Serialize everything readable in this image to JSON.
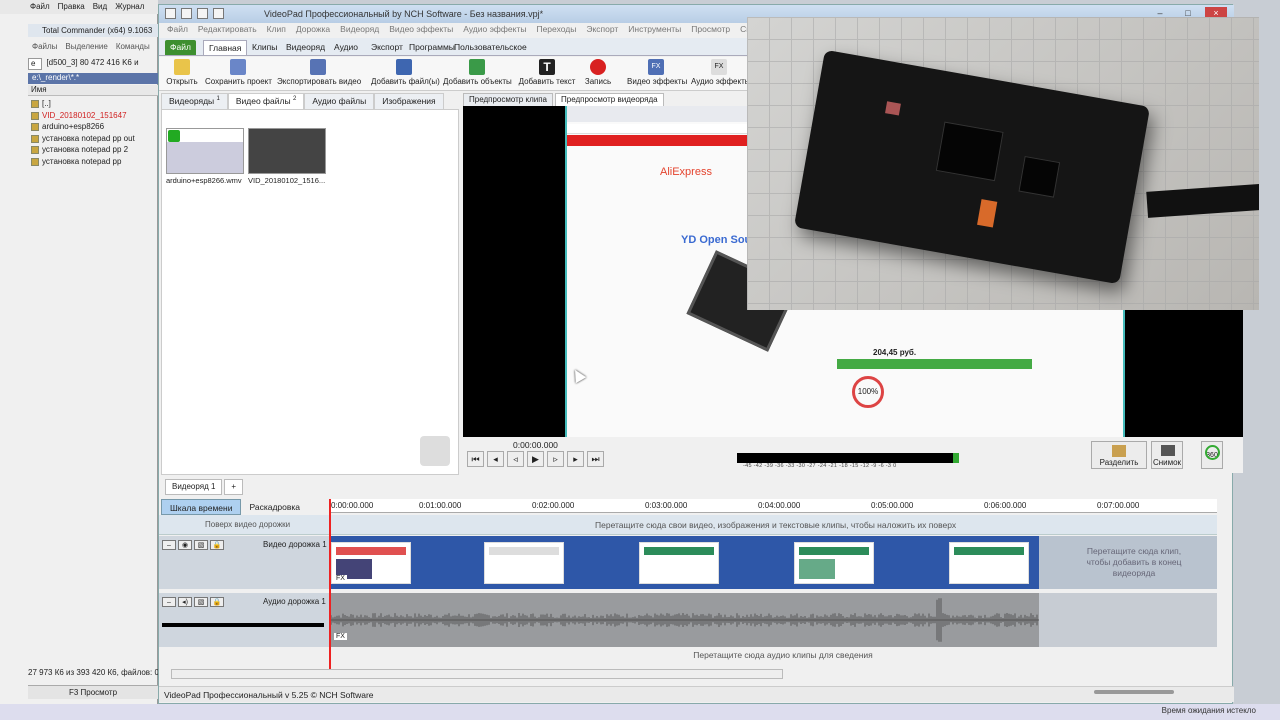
{
  "tc": {
    "menu": [
      "Файл",
      "Правка",
      "Вид",
      "Журнал"
    ],
    "title": "Total Commander (x64) 9.1063",
    "menu2": [
      "Файлы",
      "Выделение",
      "Команды"
    ],
    "drive": "e",
    "drive_info": "[d500_3]  80 472 416 K6 и",
    "path": "e:\\_render\\*.*",
    "col_name": "Имя",
    "files": [
      {
        "name": "[..]",
        "red": false
      },
      {
        "name": "VID_20180102_151647",
        "red": true
      },
      {
        "name": "arduino+esp8266",
        "red": false
      },
      {
        "name": "установка notepad pp out",
        "red": false
      },
      {
        "name": "установка notepad pp 2",
        "red": false
      },
      {
        "name": "установка notepad pp",
        "red": false
      }
    ],
    "status": "27 973 К6 из 393 420 К6, файлов: 0",
    "f3": "F3 Просмотр"
  },
  "vp": {
    "title": "VideoPad Профессиональный by NCH Software - Без названия.vpj*",
    "menu": [
      "Файл",
      "Редактировать",
      "Клип",
      "Дорожка",
      "Видеоряд",
      "Видео эффекты",
      "Аудио эффекты",
      "Переходы",
      "Экспорт",
      "Инструменты",
      "Просмотр",
      "Справка"
    ],
    "tabs": {
      "file": "Файл",
      "home": "Главная",
      "clips": "Клипы",
      "sequence": "Видеоряд",
      "audio": "Аудио",
      "export": "Экспорт",
      "programs": "Программы",
      "custom": "Пользовательское"
    },
    "ribbon": {
      "open": "Открыть",
      "save": "Сохранить проект",
      "export_video": "Экспортировать видео",
      "add_files": "Добавить файл(ы)",
      "add_objects": "Добавить объекты",
      "add_text": "Добавить текст",
      "record": "Запись",
      "video_effects": "Видео эффекты",
      "audio_effects": "Аудио эффекты"
    },
    "bin_tabs": {
      "sequences": "Видеоряды",
      "sequences_count": "1",
      "video": "Видео файлы",
      "video_count": "2",
      "audio": "Аудио файлы",
      "images": "Изображения"
    },
    "bin_items": [
      "arduino+esp8266.wmv",
      "VID_20180102_1516..."
    ],
    "preview_tabs": {
      "clip": "Предпросмотр клипа",
      "sequence": "Предпросмотр видеоряда"
    },
    "webpage": {
      "brand": "AliExpress",
      "product": "YD Open Source Har",
      "price": "204,45 руб.",
      "rating": "100%"
    },
    "time": "0:00:00.000",
    "meter_scale": "-45 -42 -39 -36 -33 -30 -27 -24 -21 -18 -15 -12 -9 -6 -3 0",
    "split": "Разделить",
    "snapshot": "Снимок",
    "deg360": "360",
    "seq_tab": "Видеоряд 1",
    "seq_add": "+",
    "mode_timeline": "Шкала времени",
    "mode_storyboard": "Раскадровка",
    "ruler": [
      "0:00:00.000",
      "0:01:00.000",
      "0:02:00.000",
      "0:03:00.000",
      "0:04:00.000",
      "0:05:00.000",
      "0:06:00.000",
      "0:07:00.000"
    ],
    "overlay_label": "Поверх видео дорожки",
    "overlay_msg": "Перетащите сюда свои видео, изображения и текстовые клипы, чтобы наложить их поверх",
    "video_track": "Видео дорожка 1",
    "video_end_msg": "Перетащите сюда клип, чтобы добавить в конец видеоряда",
    "audio_track": "Аудио дорожка 1",
    "audio_msg": "Перетащите сюда аудио клипы для сведения",
    "fx": "FX",
    "status": "VideoPad Профессиональный v 5.25 © NCH Software"
  },
  "taskbar": {
    "msg": "Время ожидания истекло"
  }
}
